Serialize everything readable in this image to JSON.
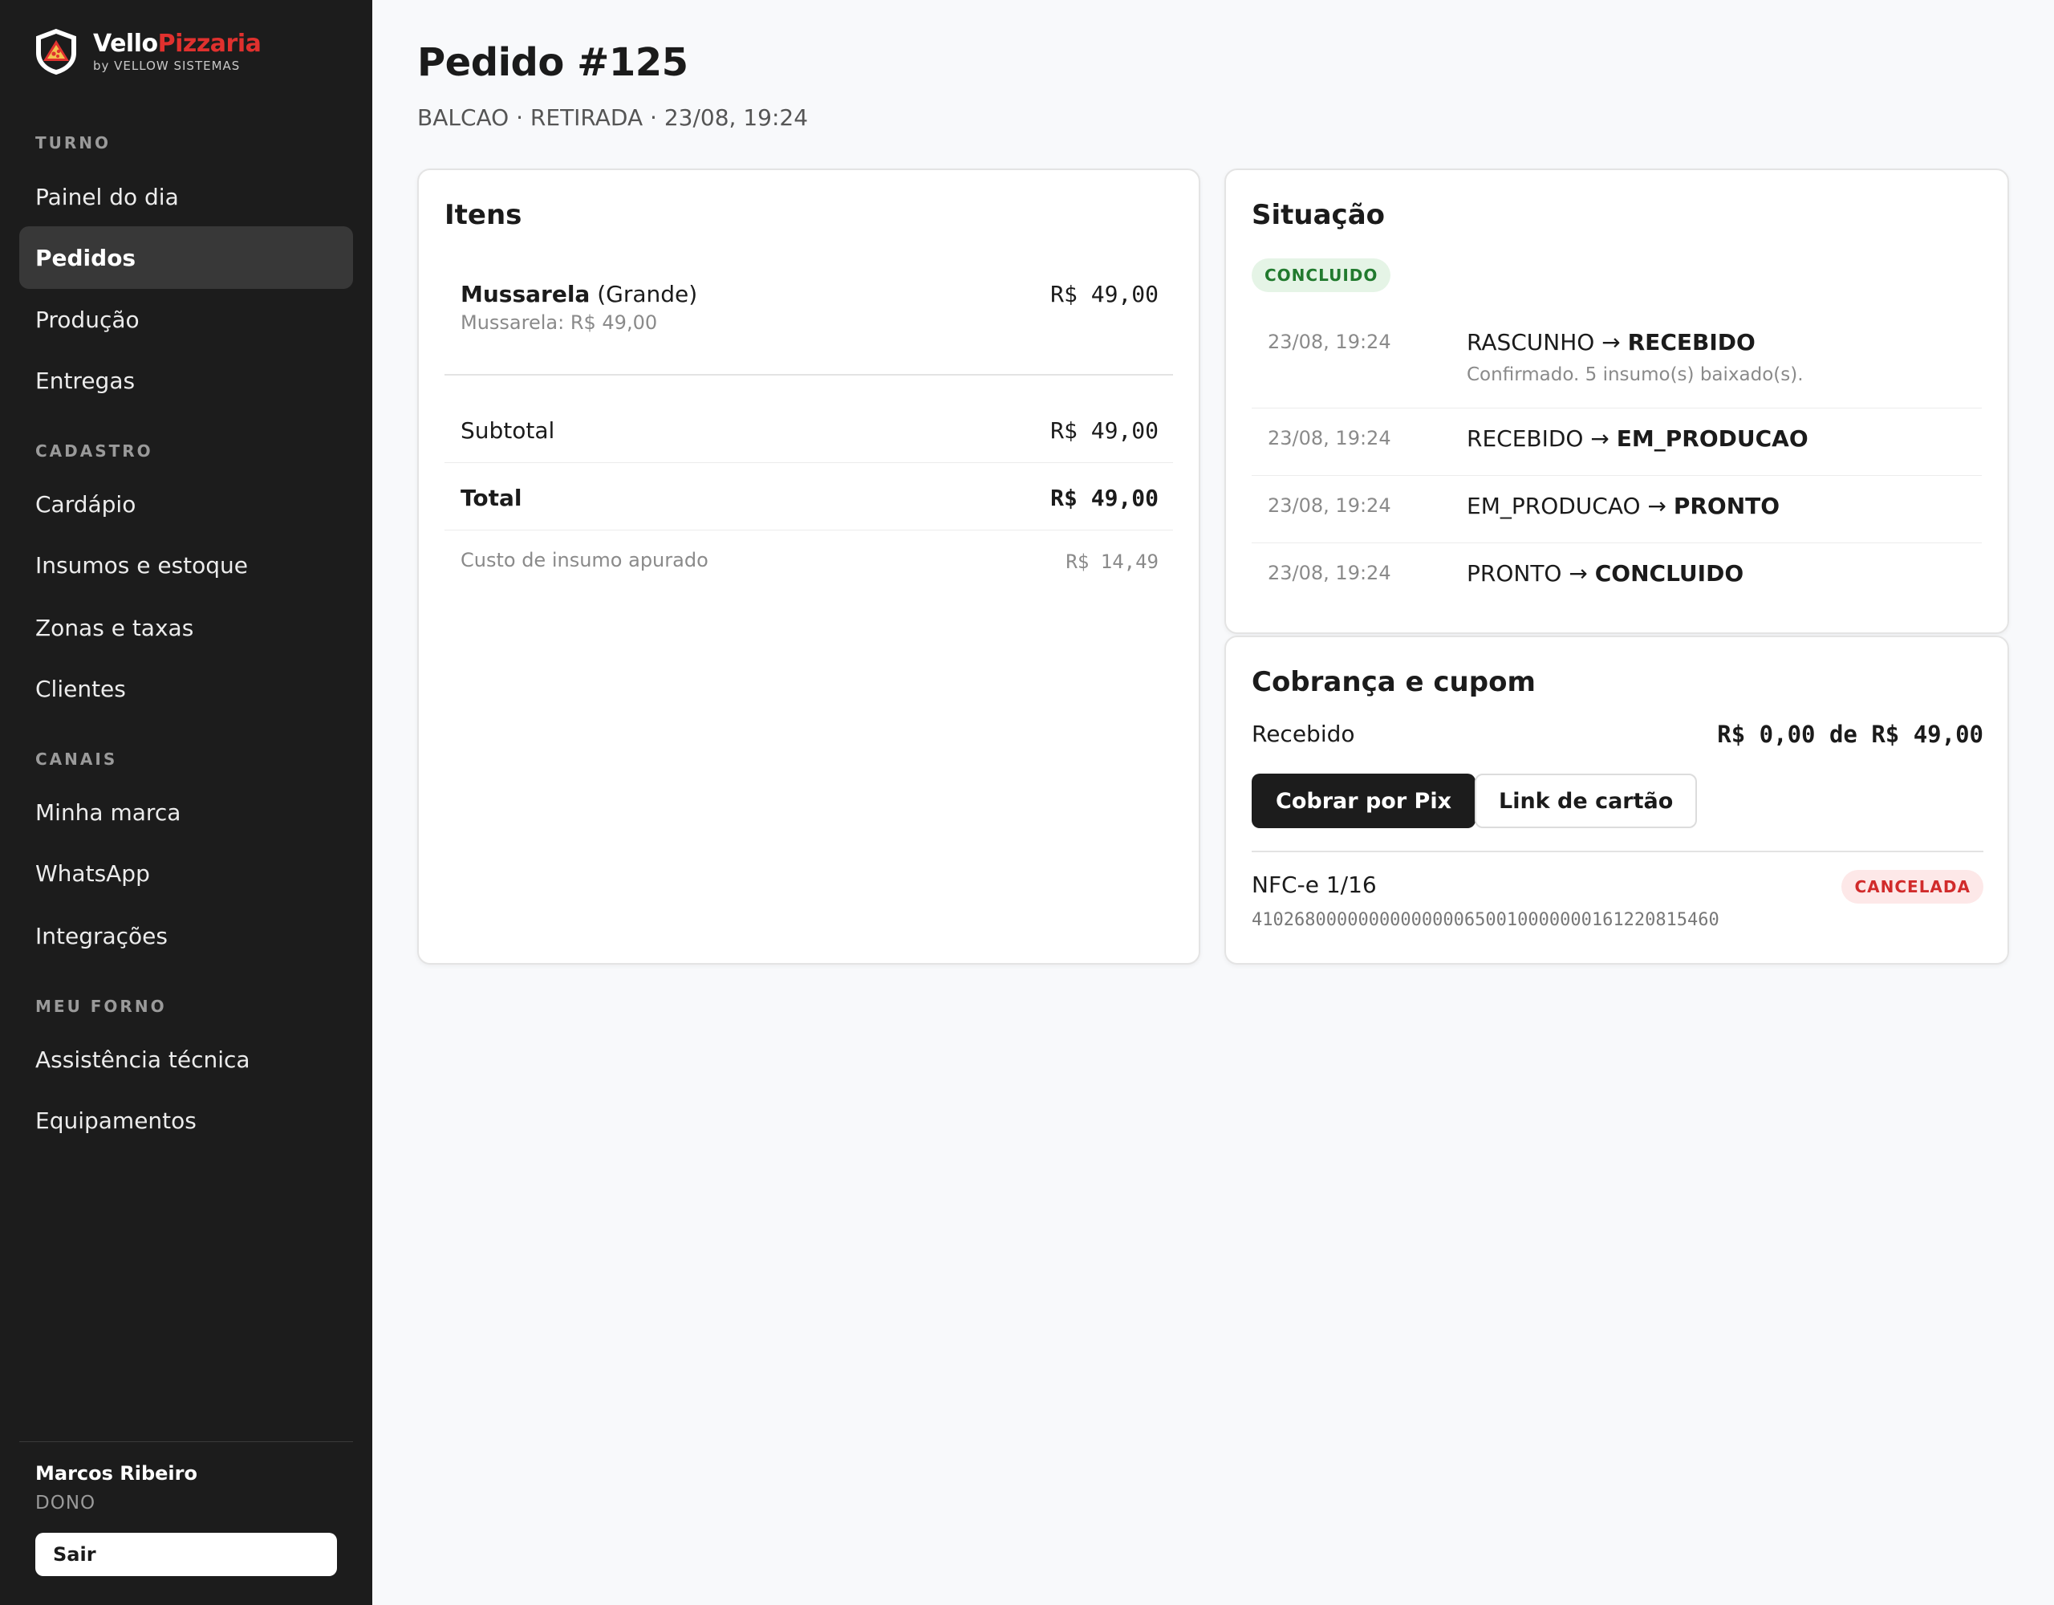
{
  "brand": {
    "name_part1": "Vello",
    "name_part2": "Pizzaria",
    "subtitle": "by VELLOW SISTEMAS",
    "accent_color": "#e0312e"
  },
  "sidebar": {
    "sections": [
      {
        "label": "TURNO",
        "items": [
          {
            "label": "Painel do dia",
            "active": false
          },
          {
            "label": "Pedidos",
            "active": true
          },
          {
            "label": "Produção",
            "active": false
          },
          {
            "label": "Entregas",
            "active": false
          }
        ]
      },
      {
        "label": "CADASTRO",
        "items": [
          {
            "label": "Cardápio",
            "active": false
          },
          {
            "label": "Insumos e estoque",
            "active": false
          },
          {
            "label": "Zonas e taxas",
            "active": false
          },
          {
            "label": "Clientes",
            "active": false
          }
        ]
      },
      {
        "label": "CANAIS",
        "items": [
          {
            "label": "Minha marca",
            "active": false
          },
          {
            "label": "WhatsApp",
            "active": false
          },
          {
            "label": "Integrações",
            "active": false
          }
        ]
      },
      {
        "label": "MEU FORNO",
        "items": [
          {
            "label": "Assistência técnica",
            "active": false
          },
          {
            "label": "Equipamentos",
            "active": false
          }
        ]
      }
    ],
    "user": {
      "name": "Marcos Ribeiro",
      "role": "DONO",
      "logout_label": "Sair"
    }
  },
  "order": {
    "title": "Pedido #125",
    "subtitle": "BALCAO · RETIRADA · 23/08, 19:24"
  },
  "items_card": {
    "title": "Itens",
    "items": [
      {
        "name": "Mussarela",
        "size": "(Grande)",
        "detail": "Mussarela: R$ 49,00",
        "price": "R$ 49,00"
      }
    ],
    "subtotal_label": "Subtotal",
    "subtotal_value": "R$ 49,00",
    "total_label": "Total",
    "total_value": "R$ 49,00",
    "cost_label": "Custo de insumo apurado",
    "cost_value": "R$ 14,49"
  },
  "status_card": {
    "title": "Situação",
    "badge": "CONCLUIDO",
    "badge_color": "#217a2e",
    "timeline": [
      {
        "time": "23/08, 19:24",
        "from": "RASCUNHO",
        "arrow": "→",
        "to": "RECEBIDO",
        "note": "Confirmado. 5 insumo(s) baixado(s)."
      },
      {
        "time": "23/08, 19:24",
        "from": "RECEBIDO",
        "arrow": "→",
        "to": "EM_PRODUCAO"
      },
      {
        "time": "23/08, 19:24",
        "from": "EM_PRODUCAO",
        "arrow": "→",
        "to": "PRONTO"
      },
      {
        "time": "23/08, 19:24",
        "from": "PRONTO",
        "arrow": "→",
        "to": "CONCLUIDO"
      }
    ]
  },
  "billing_card": {
    "title": "Cobrança e cupom",
    "received_label": "Recebido",
    "received_value": "R$ 0,00 de R$ 49,00",
    "pix_button": "Cobrar por Pix",
    "card_link_button": "Link de cartão",
    "nfce_label": "NFC-e 1/16",
    "nfce_status": "CANCELADA",
    "nfce_status_color": "#d12b2b",
    "nfce_key": "41026800000000000000650010000000161220815460"
  }
}
